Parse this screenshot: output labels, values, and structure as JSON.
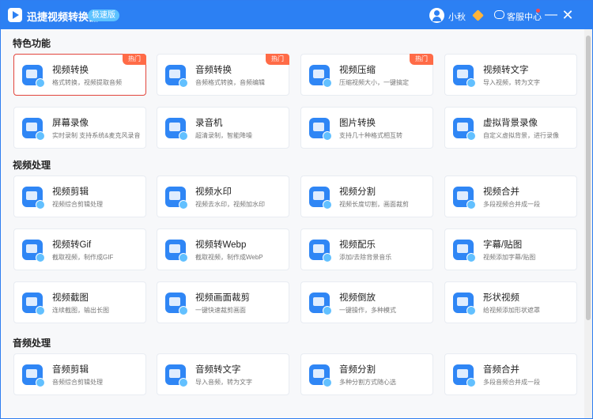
{
  "app": {
    "title": "迅捷视频转换器",
    "edition": "极速版",
    "user_name": "小秋",
    "service": "客服中心",
    "minimize": "—",
    "close": "✕"
  },
  "sections": [
    {
      "title": "特色功能",
      "cards": [
        {
          "title": "视频转换",
          "desc": "格式转换，视频提取音频",
          "badge": "热门",
          "icon": "video-convert-icon",
          "selected": true
        },
        {
          "title": "音频转换",
          "desc": "音频格式转换，音频编辑",
          "badge": "热门",
          "icon": "audio-convert-icon"
        },
        {
          "title": "视频压缩",
          "desc": "压缩视频大小，一键搞定",
          "badge": "热门",
          "icon": "video-compress-icon"
        },
        {
          "title": "视频转文字",
          "desc": "导入视频，转为文字",
          "icon": "video-to-text-icon"
        },
        {
          "title": "屏幕录像",
          "desc": "实时录制 支持系统&麦克风录音",
          "icon": "screen-record-icon"
        },
        {
          "title": "录音机",
          "desc": "超清录制，智能降噪",
          "icon": "recorder-icon"
        },
        {
          "title": "图片转换",
          "desc": "支持几十种格式相互转",
          "icon": "image-convert-icon"
        },
        {
          "title": "虚拟背景录像",
          "desc": "自定义虚拟背景，进行录像",
          "icon": "virtual-background-icon"
        }
      ]
    },
    {
      "title": "视频处理",
      "cards": [
        {
          "title": "视频剪辑",
          "desc": "视频综合剪辑处理",
          "icon": "video-edit-icon"
        },
        {
          "title": "视频水印",
          "desc": "视频去水印，视频加水印",
          "icon": "video-watermark-icon"
        },
        {
          "title": "视频分割",
          "desc": "视频长度切割，画面裁剪",
          "icon": "video-split-icon"
        },
        {
          "title": "视频合并",
          "desc": "多段视频合并成一段",
          "icon": "video-merge-icon"
        },
        {
          "title": "视频转Gif",
          "desc": "截取视频，制作成GIF",
          "icon": "gif-icon"
        },
        {
          "title": "视频转Webp",
          "desc": "截取视频，制作成WebP",
          "icon": "webp-icon"
        },
        {
          "title": "视频配乐",
          "desc": "添加/去除背景音乐",
          "icon": "video-music-icon"
        },
        {
          "title": "字幕/贴图",
          "desc": "视频添加字幕/贴图",
          "icon": "subtitle-sticker-icon"
        },
        {
          "title": "视频截图",
          "desc": "连续截图，输出长图",
          "icon": "video-screenshot-icon"
        },
        {
          "title": "视频画面裁剪",
          "desc": "一键快速裁剪画面",
          "icon": "video-crop-icon"
        },
        {
          "title": "视频倒放",
          "desc": "一键操作，多种模式",
          "icon": "video-reverse-icon"
        },
        {
          "title": "形状视频",
          "desc": "给视频添加形状遮罩",
          "icon": "shape-video-icon"
        }
      ]
    },
    {
      "title": "音频处理",
      "cards": [
        {
          "title": "音频剪辑",
          "desc": "音频综合剪辑处理",
          "icon": "audio-edit-icon"
        },
        {
          "title": "音频转文字",
          "desc": "导入音频，转为文字",
          "icon": "audio-to-text-icon"
        },
        {
          "title": "音频分割",
          "desc": "多种分割方式随心选",
          "icon": "audio-split-icon"
        },
        {
          "title": "音频合并",
          "desc": "多段音频合并成一段",
          "icon": "audio-merge-icon"
        }
      ]
    }
  ]
}
